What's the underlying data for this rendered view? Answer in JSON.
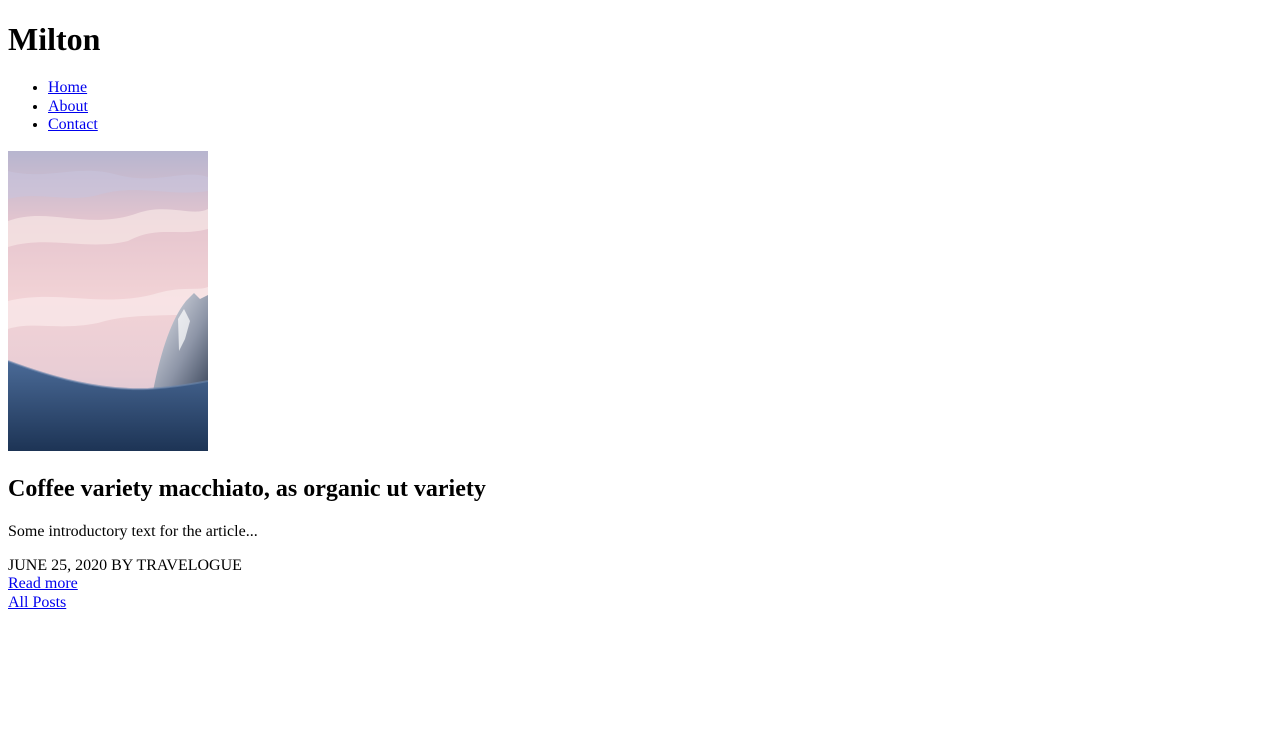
{
  "site": {
    "title": "Milton"
  },
  "nav": {
    "items": [
      {
        "label": "Home"
      },
      {
        "label": "About"
      },
      {
        "label": "Contact"
      }
    ]
  },
  "post": {
    "image": {
      "subject": "mountain-sunset"
    },
    "title": "Coffee variety macchiato, as organic ut variety",
    "excerpt": "Some introductory text for the article...",
    "meta": "JUNE 25, 2020 BY TRAVELOGUE",
    "read_more": "Read more"
  },
  "footer": {
    "all_posts": "All Posts"
  },
  "colors": {
    "link": "#0000ee",
    "text": "#000000",
    "background": "#ffffff"
  }
}
